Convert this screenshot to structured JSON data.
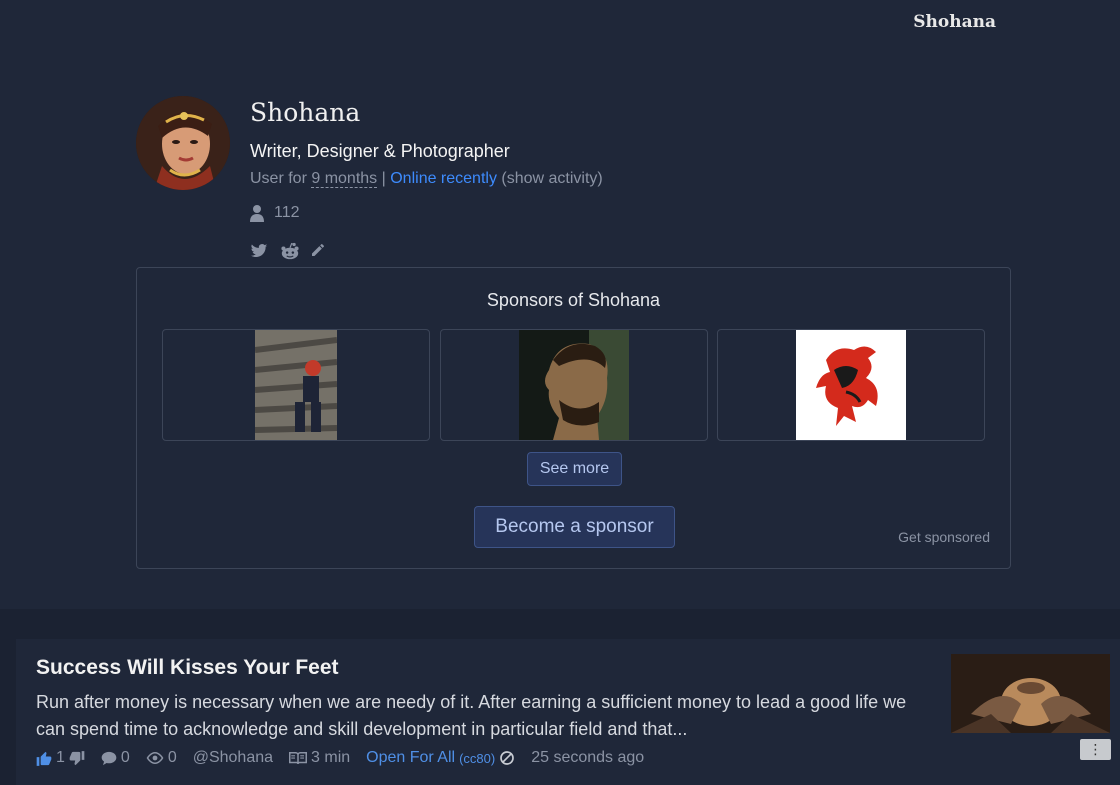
{
  "header": {
    "username": "Shohana"
  },
  "profile": {
    "name": "Shohana",
    "headline": "Writer, Designer & Photographer",
    "member_prefix": "User for",
    "member_duration": "9 months",
    "separator": "|",
    "status": "Online recently",
    "show_activity": "(show activity)",
    "followers": "112",
    "social_icons": [
      "twitter-icon",
      "reddit-icon",
      "pencil-icon"
    ]
  },
  "sponsors": {
    "title": "Sponsors of Shohana",
    "see_more_label": "See more",
    "become_label": "Become a sponsor",
    "get_sponsored_label": "Get sponsored"
  },
  "post": {
    "title": "Success Will Kisses Your Feet",
    "excerpt": "Run after money is necessary when we are needy of it. After earning a sufficient money to lead a good life we can spend time to acknowledge and skill development in particular field and that...",
    "upvotes": "1",
    "comments": "0",
    "views": "0",
    "author": "@Shohana",
    "read_time": "3 min",
    "license": "Open For All",
    "license_code": "(cc80)",
    "time": "25 seconds ago",
    "menu_label": "⋮"
  },
  "colors": {
    "background": "#1f2739",
    "accent": "#3d8bfd",
    "button_bg": "#263459"
  }
}
